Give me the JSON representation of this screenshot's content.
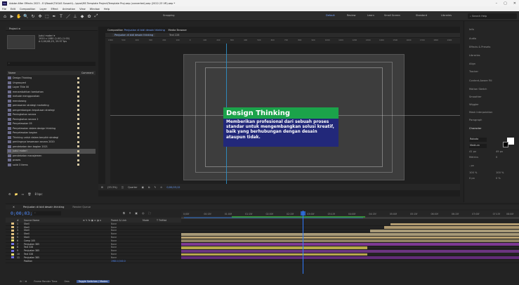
{
  "window": {
    "title": "Adobe After Effects 2023 - E:\\Ebook\\TUGAS Susanti\\...\\apro\\MS Template Project\\Template Proj.aep (converted).aep (2022.23 VR).aep *",
    "controls": [
      "–",
      "▢",
      "✕"
    ]
  },
  "menu": [
    "File",
    "Edit",
    "Composition",
    "Layer",
    "Effect",
    "Animation",
    "View",
    "Window",
    "Help"
  ],
  "toolbar": {
    "tools": [
      "⌂",
      "▶",
      "✋",
      "🔍",
      "↻",
      "✥",
      "⬚",
      "✒",
      "T",
      "／",
      "⊥",
      "◆",
      "✿",
      "⤢"
    ],
    "snapping_label": "Snapping",
    "workspaces": [
      "Default",
      "Review",
      "Learn",
      "Small Screen",
      "Standard",
      "Libraries"
    ],
    "active_workspace": "Default",
    "search_help_placeholder": "Search Help"
  },
  "project": {
    "panel_title": "Project ≡",
    "info_lines": [
      "Judul materi ▾",
      "1920 x 1080 (1.00) (1.00)",
      "Δ 0;00;08;23, 29.97 fps"
    ],
    "search_placeholder": "⌕",
    "col_name": "Name",
    "col_comment": "Comment",
    "items": [
      {
        "name": "Design Thinking",
        "sel": false
      },
      {
        "name": "Ungrouped",
        "sel": false
      },
      {
        "name": "Layer Title 00",
        "sel": false
      },
      {
        "name": "menambahkan tambahan",
        "sel": false
      },
      {
        "name": "metode menggunakan",
        "sel": false
      },
      {
        "name": "mendorong",
        "sel": false
      },
      {
        "name": "pemasaran strategi marketing",
        "sel": false
      },
      {
        "name": "pengembangan keputusan strategi",
        "sel": false
      },
      {
        "name": "Peningkatan secara",
        "sel": false
      },
      {
        "name": "Peningkatan secara 2",
        "sel": false
      },
      {
        "name": "Penyelesaian 05",
        "sel": false
      },
      {
        "name": "Penyelesaian dalam design thinking",
        "sel": false
      },
      {
        "name": "Penyelesaian bagian",
        "sel": false
      },
      {
        "name": "Thinking untuk dalam berpikir strategi",
        "sel": false
      },
      {
        "name": "pentingnya kesamaan secara 2020",
        "sel": false
      },
      {
        "name": "pendekatan dan bagian 2021",
        "sel": false
      },
      {
        "name": "Judul materi",
        "sel": true
      },
      {
        "name": "pendekatan manajemen",
        "sel": false
      },
      {
        "name": "proses",
        "sel": false
      },
      {
        "name": "solid 3 items",
        "sel": false
      }
    ],
    "bottom_icons": [
      "⚙",
      "📁",
      "▭",
      "🗑",
      "8 bpc"
    ]
  },
  "viewer": {
    "panel_prefix": "Composition",
    "comp_name": "Penjualan di bidi desain thinking",
    "extra_tab": "Media Browser",
    "flow_tabs": [
      "Penjualan di bidi desain thinking",
      "Text 228"
    ],
    "ruler_ticks": [
      "1300",
      "500",
      "400",
      "300",
      "200",
      "100",
      "0",
      "100",
      "200",
      "300",
      "400",
      "500",
      "600",
      "700",
      "800",
      "900",
      "1000",
      "1100",
      "1200",
      "1300",
      "1400",
      "1500",
      "1600",
      "1700",
      "1800",
      "1900"
    ],
    "footer": {
      "zoom": "(33.3%)",
      "quality": "Quarter",
      "timecode": "0;00;03;12",
      "icons": [
        "⊞",
        "◫",
        "▣",
        "⧉",
        "✎",
        "⊙"
      ]
    }
  },
  "slide": {
    "title": "Design Thinking",
    "body": "Memberikan profesional dari sebuah proses standar untuk mengembangkan solusi kreatif, baik yang berhubungan dengan desain ataupun tidak.",
    "colors": {
      "title_bg": "#1ba34a",
      "body_bg": "#22287a",
      "text": "#ffffff"
    }
  },
  "right_panel": {
    "items": [
      "Info",
      "Audio",
      "Effects & Presets",
      "Libraries",
      "Align",
      "Tracker",
      "Content-Aware Fill",
      "Motion Sketch",
      "Smoother",
      "Wiggler",
      "Mask Interpolation",
      "Paragraph",
      "Character"
    ],
    "character": {
      "font": "Roboto",
      "style": "Medium",
      "size": "41 px",
      "leading": "49 px",
      "tracking": "Metrics",
      "kerning": "0",
      "stroke": "- px",
      "vscale": "100 %",
      "hscale": "100 %",
      "baseline": "0 px",
      "tsume": "0 %"
    }
  },
  "timeline": {
    "tab_active": "Penjualan di bidi desain thinking",
    "tab_other": "Render Queue",
    "timecode": "0;00;03;12",
    "search_placeholder": "⌕",
    "icons": [
      "⧉",
      "⌾",
      "▣",
      "◎",
      "⛶"
    ],
    "ruler": [
      "0;00f",
      "00:15f",
      "01:00f",
      "01:15f",
      "02:00f",
      "02:15f",
      "03:00f",
      "03:15f",
      "04:00f",
      "04:15f",
      "05:00f",
      "05:15f",
      "06:00f",
      "06:15f",
      "07:00f",
      "07:15f",
      "08:00f"
    ],
    "col_labels": [
      "# ",
      "Source Name",
      "⊕ ✎ fx ▣ ⊘ ◑ ⊙",
      "Parent & Link",
      "Mode",
      "T TrkMat"
    ],
    "layers": [
      {
        "num": "1",
        "name": "Shell",
        "color": "#e0c080",
        "mode": "None",
        "bar": {
          "start": 0.62,
          "end": 1.0,
          "color": "#b09a70"
        }
      },
      {
        "num": "2",
        "name": "Shell",
        "color": "#e0c080",
        "mode": "None",
        "bar": {
          "start": 0.6,
          "end": 1.0,
          "color": "#b09a70"
        }
      },
      {
        "num": "3",
        "name": "Shell",
        "color": "#e0c080",
        "mode": "None",
        "bar": {
          "start": 0.56,
          "end": 1.0,
          "color": "#a89a78"
        }
      },
      {
        "num": "4",
        "name": "Shell",
        "color": "#e0c080",
        "mode": "None",
        "bar": {
          "start": 0.0,
          "end": 1.0,
          "color": "#a89a78"
        }
      },
      {
        "num": "5",
        "name": "Shell",
        "color": "#e0c080",
        "mode": "None",
        "bar": {
          "start": 0.0,
          "end": 1.0,
          "color": "#b8a070"
        }
      },
      {
        "num": "6",
        "name": "Comp 105",
        "color": "#e8e070",
        "mode": "None",
        "bar": {
          "start": 0.0,
          "end": 1.0,
          "color": "#8f8262"
        }
      },
      {
        "num": "7",
        "name": "Penjualan 385",
        "color": "#7070e0",
        "mode": "None",
        "bar": {
          "start": 0.0,
          "end": 1.0,
          "color": "#7e3a93"
        }
      },
      {
        "num": "8",
        "name": "Text 328",
        "color": "#e8e070",
        "mode": "None",
        "bar": {
          "start": 0.0,
          "end": 0.55,
          "color": "#b6a84a"
        }
      },
      {
        "num": "9",
        "name": "Penjualan 385",
        "color": "#7070e0",
        "mode": "None",
        "bar": {
          "start": 0.0,
          "end": 1.0,
          "color": "#6b3580"
        }
      },
      {
        "num": "10",
        "name": "Text 328",
        "color": "#e8e070",
        "mode": "None",
        "bar": {
          "start": 0.0,
          "end": 0.55,
          "color": "#b8a450"
        }
      },
      {
        "num": "11",
        "name": "Penjualan 385",
        "color": "#7070e0",
        "mode": "None",
        "bar": {
          "start": 0.0,
          "end": 1.0,
          "color": "#612c78"
        }
      },
      {
        "num": "",
        "name": "Position",
        "color": "",
        "mode": "",
        "bar": null
      }
    ],
    "position_value": "1980.0,540.0",
    "playhead": 0.36,
    "footer": {
      "left_icons": "⚙ ⛶ ⊕",
      "frame_render": "Frame Render Time",
      "frame_ms": "0ms",
      "toggle": "Toggle Switches / Modes"
    }
  }
}
